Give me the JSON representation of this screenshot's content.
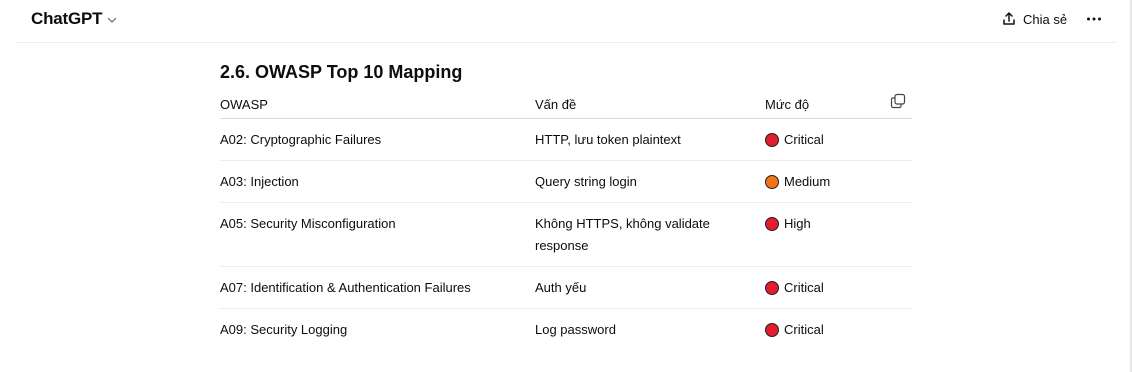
{
  "header": {
    "title": "ChatGPT",
    "share_label": "Chia sẻ"
  },
  "section": {
    "title": "2.6. OWASP Top 10 Mapping"
  },
  "table": {
    "columns": [
      "OWASP",
      "Vấn đề",
      "Mức độ"
    ],
    "rows": [
      {
        "owasp": "A02: Cryptographic Failures",
        "issue": "HTTP, lưu token plaintext",
        "severity": "Critical",
        "color": "#e11d2e"
      },
      {
        "owasp": "A03: Injection",
        "issue": "Query string login",
        "severity": "Medium",
        "color": "#f07318"
      },
      {
        "owasp": "A05: Security Misconfiguration",
        "issue": "Không HTTPS, không validate response",
        "severity": "High",
        "color": "#e11d2e"
      },
      {
        "owasp": "A07: Identification & Authentication Failures",
        "issue": "Auth yếu",
        "severity": "Critical",
        "color": "#e11d2e"
      },
      {
        "owasp": "A09: Security Logging",
        "issue": "Log password",
        "severity": "Critical",
        "color": "#e11d2e"
      }
    ]
  },
  "icons": {
    "title_chevron": "chevron-down-icon",
    "share": "share-upload-icon",
    "more": "more-horizontal-icon",
    "copy": "copy-icon"
  }
}
